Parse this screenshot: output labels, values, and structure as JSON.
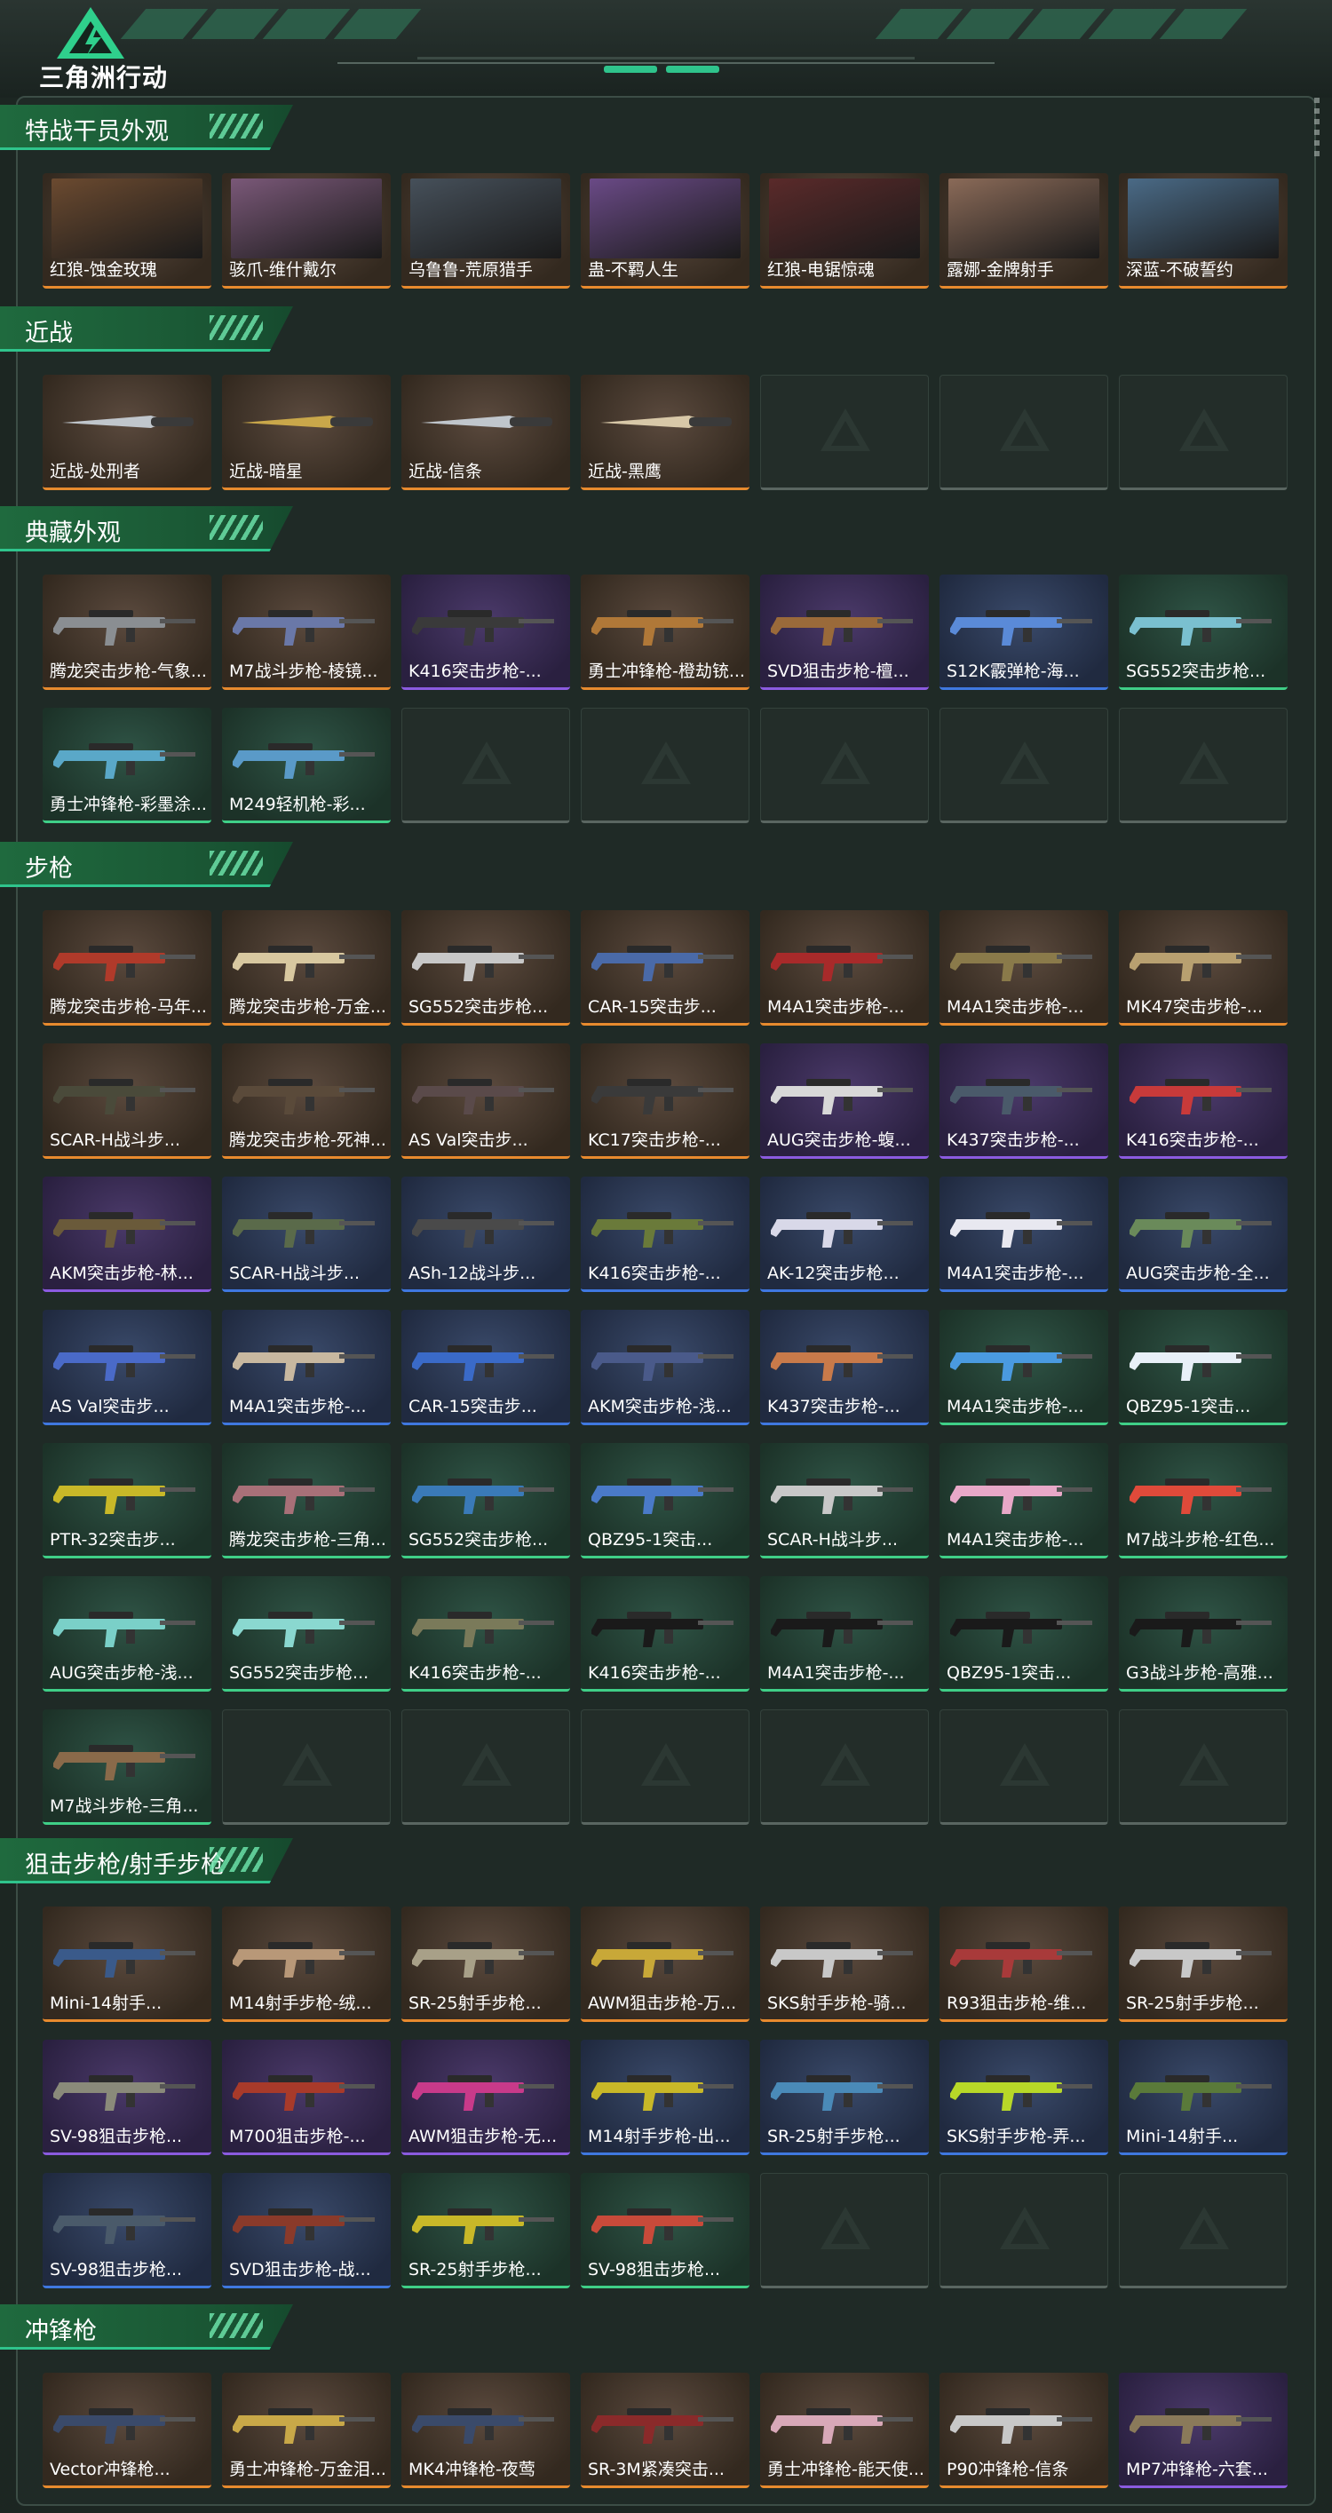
{
  "app": {
    "logo_text": "三角洲行动"
  },
  "sections": [
    {
      "title": "特战干员外观",
      "kind": "portrait",
      "items": [
        {
          "label": "红狼-蚀金玫瑰",
          "rarity": "orange",
          "portrait": "#6b4a30"
        },
        {
          "label": "骇爪-维什戴尔",
          "rarity": "orange",
          "portrait": "#7a5878"
        },
        {
          "label": "乌鲁鲁-荒原猎手",
          "rarity": "orange",
          "portrait": "#46505a"
        },
        {
          "label": "蛊-不羁人生",
          "rarity": "orange",
          "portrait": "#6a4a86"
        },
        {
          "label": "红狼-电锯惊魂",
          "rarity": "orange",
          "portrait": "#5a2a2a"
        },
        {
          "label": "露娜-金牌射手",
          "rarity": "orange",
          "portrait": "#8a6a58"
        },
        {
          "label": "深蓝-不破誓约",
          "rarity": "orange",
          "portrait": "#4a6a86"
        }
      ],
      "empty": 0
    },
    {
      "title": "近战",
      "kind": "weapon",
      "items": [
        {
          "label": "近战-处刑者",
          "rarity": "orange",
          "color": "#c0c6cc"
        },
        {
          "label": "近战-暗星",
          "rarity": "orange",
          "color": "#c9a74a"
        },
        {
          "label": "近战-信条",
          "rarity": "orange",
          "color": "#c0c6cc"
        },
        {
          "label": "近战-黑鹰",
          "rarity": "orange",
          "color": "#d8c8a8"
        }
      ],
      "empty": 3
    },
    {
      "title": "典藏外观",
      "kind": "weapon",
      "items": [
        {
          "label": "腾龙突击步枪-气象...",
          "rarity": "orange",
          "color": "#8a8e92"
        },
        {
          "label": "M7战斗步枪-棱镜...",
          "rarity": "orange",
          "color": "#6a78a8"
        },
        {
          "label": "K416突击步枪-...",
          "rarity": "purple",
          "color": "#3a3a3a"
        },
        {
          "label": "勇士冲锋枪-橙劫铳...",
          "rarity": "orange",
          "color": "#b07838"
        },
        {
          "label": "SVD狙击步枪-檀...",
          "rarity": "purple",
          "color": "#9a6a3a"
        },
        {
          "label": "S12K霰弹枪-海...",
          "rarity": "blue",
          "color": "#5a8ad8"
        },
        {
          "label": "SG552突击步枪...",
          "rarity": "green",
          "color": "#7ac0d0"
        },
        {
          "label": "勇士冲锋枪-彩墨涂...",
          "rarity": "green",
          "color": "#5aa8c8"
        },
        {
          "label": "M249轻机枪-彩...",
          "rarity": "green",
          "color": "#5a9ac8"
        }
      ],
      "empty": 5
    },
    {
      "title": "步枪",
      "kind": "weapon",
      "items": [
        {
          "label": "腾龙突击步枪-马年...",
          "rarity": "orange",
          "color": "#b03a2a"
        },
        {
          "label": "腾龙突击步枪-万金...",
          "rarity": "orange",
          "color": "#d8c8a0"
        },
        {
          "label": "SG552突击步枪...",
          "rarity": "orange",
          "color": "#c8c8c8"
        },
        {
          "label": "CAR-15突击步...",
          "rarity": "orange",
          "color": "#4a6aa8"
        },
        {
          "label": "M4A1突击步枪-...",
          "rarity": "orange",
          "color": "#a82a2a"
        },
        {
          "label": "M4A1突击步枪-...",
          "rarity": "orange",
          "color": "#8a7a4a"
        },
        {
          "label": "MK47突击步枪-...",
          "rarity": "orange",
          "color": "#b8a070"
        },
        {
          "label": "SCAR-H战斗步...",
          "rarity": "orange",
          "color": "#4a4a3a"
        },
        {
          "label": "腾龙突击步枪-死神...",
          "rarity": "orange",
          "color": "#5a4a3a"
        },
        {
          "label": "AS Val突击步...",
          "rarity": "orange",
          "color": "#5a4a4a"
        },
        {
          "label": "KC17突击步枪-...",
          "rarity": "orange",
          "color": "#3a3a3a"
        },
        {
          "label": "AUG突击步枪-蝮...",
          "rarity": "purple",
          "color": "#d8d8d8"
        },
        {
          "label": "K437突击步枪-...",
          "rarity": "purple",
          "color": "#4a5a6a"
        },
        {
          "label": "K416突击步枪-...",
          "rarity": "purple",
          "color": "#c83a3a"
        },
        {
          "label": "AKM突击步枪-林...",
          "rarity": "purple",
          "color": "#6a5a3a"
        },
        {
          "label": "SCAR-H战斗步...",
          "rarity": "blue",
          "color": "#5a6a4a"
        },
        {
          "label": "ASh-12战斗步...",
          "rarity": "blue",
          "color": "#4a4a4a"
        },
        {
          "label": "K416突击步枪-...",
          "rarity": "blue",
          "color": "#6a7a3a"
        },
        {
          "label": "AK-12突击步枪...",
          "rarity": "blue",
          "color": "#d8d8e8"
        },
        {
          "label": "M4A1突击步枪-...",
          "rarity": "blue",
          "color": "#e8e8f0"
        },
        {
          "label": "AUG突击步枪-全...",
          "rarity": "blue",
          "color": "#6a8a5a"
        },
        {
          "label": "AS Val突击步...",
          "rarity": "blue",
          "color": "#4a6ac8"
        },
        {
          "label": "M4A1突击步枪-...",
          "rarity": "blue",
          "color": "#c8b8a0"
        },
        {
          "label": "CAR-15突击步...",
          "rarity": "blue",
          "color": "#3a6ac8"
        },
        {
          "label": "AKM突击步枪-浅...",
          "rarity": "blue",
          "color": "#4a5a8a"
        },
        {
          "label": "K437突击步枪-...",
          "rarity": "blue",
          "color": "#c87a4a"
        },
        {
          "label": "M4A1突击步枪-...",
          "rarity": "green",
          "color": "#4a9ae0"
        },
        {
          "label": "QBZ95-1突击...",
          "rarity": "green",
          "color": "#e8f0f8"
        },
        {
          "label": "PTR-32突击步...",
          "rarity": "green",
          "color": "#c8b828"
        },
        {
          "label": "腾龙突击步枪-三角...",
          "rarity": "green",
          "color": "#a87078"
        },
        {
          "label": "SG552突击步枪...",
          "rarity": "green",
          "color": "#3a7ab8"
        },
        {
          "label": "QBZ95-1突击...",
          "rarity": "green",
          "color": "#4a7ac8"
        },
        {
          "label": "SCAR-H战斗步...",
          "rarity": "green",
          "color": "#c8c8c8"
        },
        {
          "label": "M4A1突击步枪-...",
          "rarity": "green",
          "color": "#e8a8c8"
        },
        {
          "label": "M7战斗步枪-红色...",
          "rarity": "green",
          "color": "#e04a3a"
        },
        {
          "label": "AUG突击步枪-浅...",
          "rarity": "green",
          "color": "#7ad0c8"
        },
        {
          "label": "SG552突击步枪...",
          "rarity": "green",
          "color": "#8ad8d0"
        },
        {
          "label": "K416突击步枪-...",
          "rarity": "green",
          "color": "#7a7a5a"
        },
        {
          "label": "K416突击步枪-...",
          "rarity": "green",
          "color": "#1a1a1a"
        },
        {
          "label": "M4A1突击步枪-...",
          "rarity": "green",
          "color": "#1a1a1a"
        },
        {
          "label": "QBZ95-1突击...",
          "rarity": "green",
          "color": "#1a1a1a"
        },
        {
          "label": "G3战斗步枪-高雅...",
          "rarity": "green",
          "color": "#1a1a1a"
        },
        {
          "label": "M7战斗步枪-三角...",
          "rarity": "green",
          "color": "#8a6a4a"
        }
      ],
      "empty": 6
    },
    {
      "title": "狙击步枪/射手步枪",
      "kind": "weapon",
      "items": [
        {
          "label": "Mini-14射手...",
          "rarity": "orange",
          "color": "#3a5a8a"
        },
        {
          "label": "M14射手步枪-绒...",
          "rarity": "orange",
          "color": "#b89878"
        },
        {
          "label": "SR-25射手步枪...",
          "rarity": "orange",
          "color": "#a8a088"
        },
        {
          "label": "AWM狙击步枪-万...",
          "rarity": "orange",
          "color": "#c8a838"
        },
        {
          "label": "SKS射手步枪-骑...",
          "rarity": "orange",
          "color": "#c8c8c8"
        },
        {
          "label": "R93狙击步枪-维...",
          "rarity": "orange",
          "color": "#a83a3a"
        },
        {
          "label": "SR-25射手步枪...",
          "rarity": "orange",
          "color": "#c8c8c8"
        },
        {
          "label": "SV-98狙击步枪...",
          "rarity": "purple",
          "color": "#8a8a7a"
        },
        {
          "label": "M700狙击步枪-...",
          "rarity": "purple",
          "color": "#a83a2a"
        },
        {
          "label": "AWM狙击步枪-无...",
          "rarity": "purple",
          "color": "#c83a8a"
        },
        {
          "label": "M14射手步枪-出...",
          "rarity": "blue",
          "color": "#c8b828"
        },
        {
          "label": "SR-25射手步枪...",
          "rarity": "blue",
          "color": "#4a8ab8"
        },
        {
          "label": "SKS射手步枪-弄...",
          "rarity": "blue",
          "color": "#b8d828"
        },
        {
          "label": "Mini-14射手...",
          "rarity": "blue",
          "color": "#5a7a3a"
        },
        {
          "label": "SV-98狙击步枪...",
          "rarity": "blue",
          "color": "#4a5a6a"
        },
        {
          "label": "SVD狙击步枪-战...",
          "rarity": "blue",
          "color": "#8a3a2a"
        },
        {
          "label": "SR-25射手步枪...",
          "rarity": "green",
          "color": "#c8b828"
        },
        {
          "label": "SV-98狙击步枪...",
          "rarity": "green",
          "color": "#c84a3a"
        }
      ],
      "empty": 3
    },
    {
      "title": "冲锋枪",
      "kind": "weapon",
      "items": [
        {
          "label": "Vector冲锋枪...",
          "rarity": "orange",
          "color": "#3a4a6a"
        },
        {
          "label": "勇士冲锋枪-万金泪...",
          "rarity": "orange",
          "color": "#c8a848"
        },
        {
          "label": "MK4冲锋枪-夜莺",
          "rarity": "orange",
          "color": "#3a4a6a"
        },
        {
          "label": "SR-3M紧凑突击...",
          "rarity": "orange",
          "color": "#8a2a2a"
        },
        {
          "label": "勇士冲锋枪-能天使...",
          "rarity": "orange",
          "color": "#d8a8b8"
        },
        {
          "label": "P90冲锋枪-信条",
          "rarity": "orange",
          "color": "#c8c8c8"
        },
        {
          "label": "MP7冲锋枪-六套...",
          "rarity": "purple",
          "color": "#8a7a5a"
        }
      ],
      "empty": 0
    }
  ]
}
